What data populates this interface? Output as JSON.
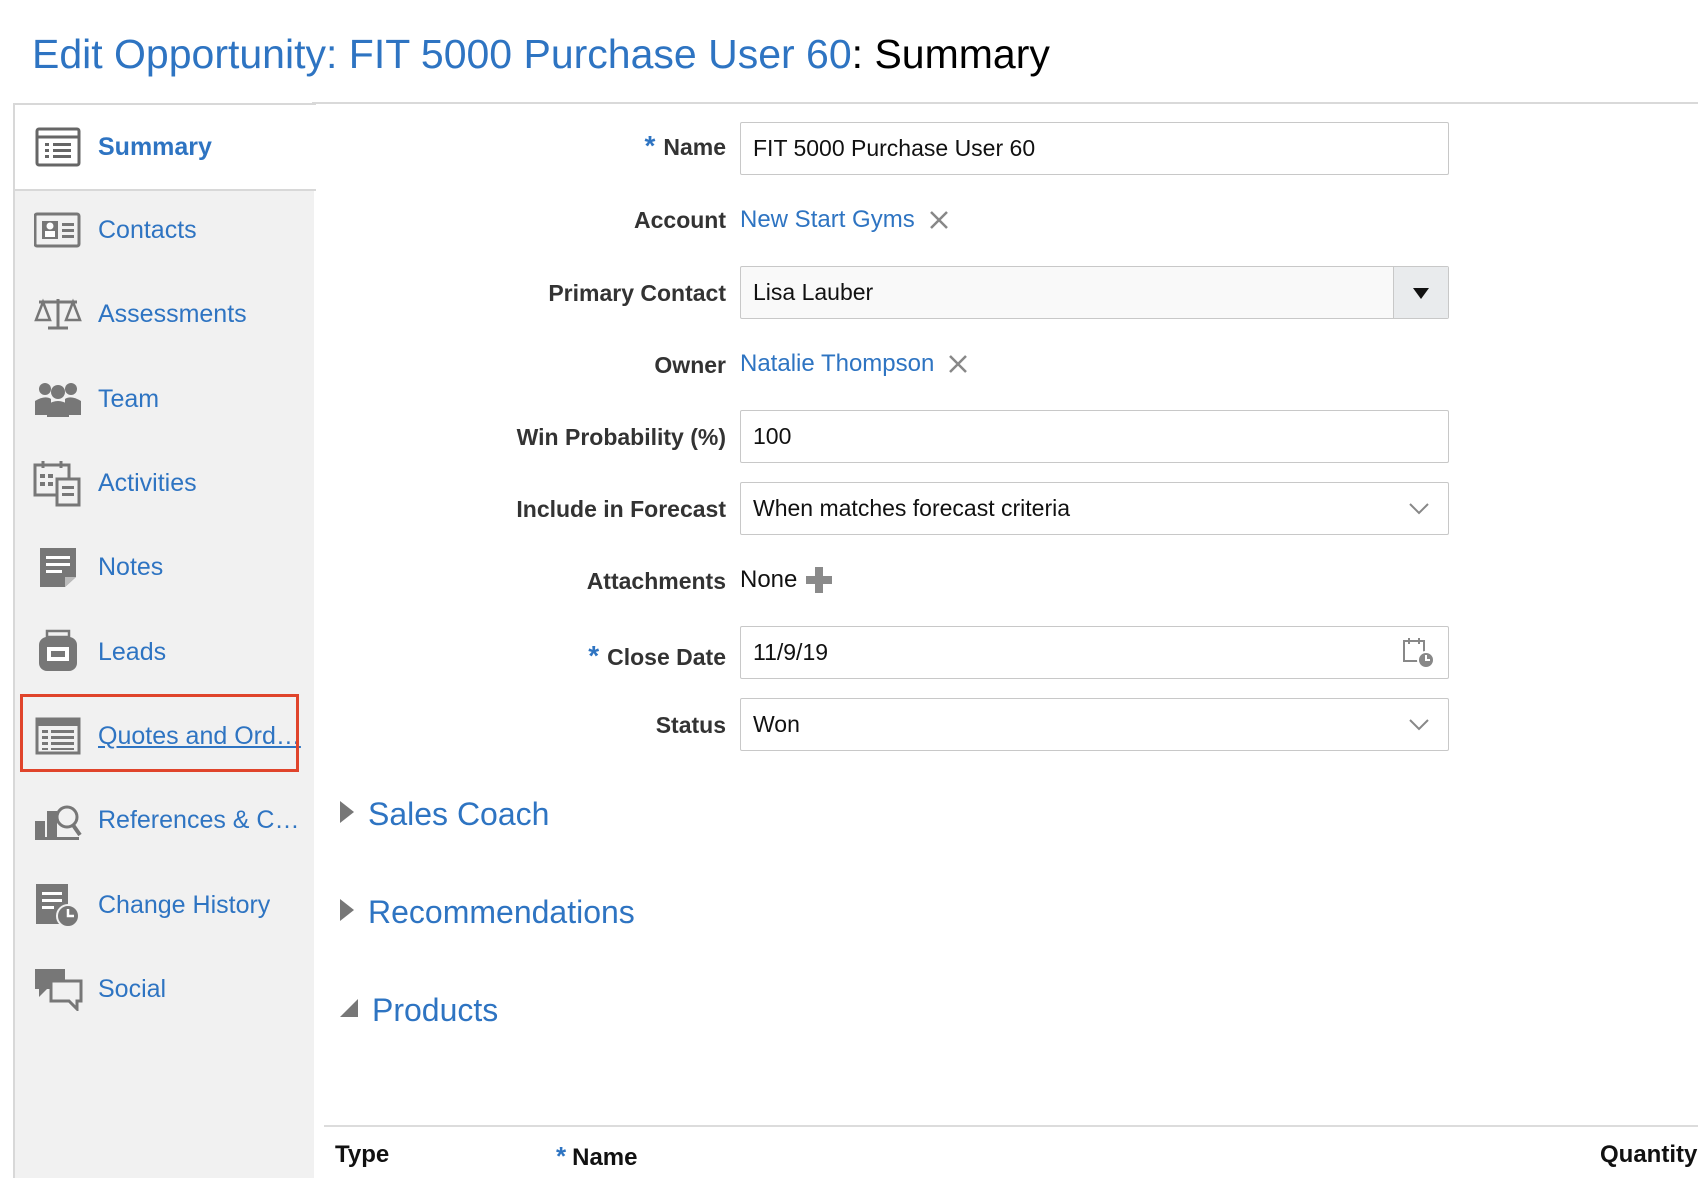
{
  "header": {
    "title_link": "Edit Opportunity: FIT 5000 Purchase User 60",
    "title_rest": ": Summary"
  },
  "sidebar": {
    "items": [
      {
        "label": "Summary",
        "icon": "summary-list-icon"
      },
      {
        "label": "Contacts",
        "icon": "contacts-card-icon"
      },
      {
        "label": "Assessments",
        "icon": "scales-icon"
      },
      {
        "label": "Team",
        "icon": "team-people-icon"
      },
      {
        "label": "Activities",
        "icon": "calendar-activities-icon"
      },
      {
        "label": "Notes",
        "icon": "notes-icon"
      },
      {
        "label": "Leads",
        "icon": "leads-icon"
      },
      {
        "label": "Quotes and Ord…",
        "icon": "quotes-table-icon"
      },
      {
        "label": "References & C…",
        "icon": "references-search-icon"
      },
      {
        "label": "Change History",
        "icon": "change-history-icon"
      },
      {
        "label": "Social",
        "icon": "social-chat-icon"
      }
    ]
  },
  "form": {
    "name_label": "Name",
    "name_value": "FIT 5000 Purchase User 60",
    "account_label": "Account",
    "account_value": "New Start Gyms",
    "primary_contact_label": "Primary Contact",
    "primary_contact_value": "Lisa Lauber",
    "owner_label": "Owner",
    "owner_value": "Natalie Thompson",
    "win_prob_label": "Win Probability (%)",
    "win_prob_value": "100",
    "forecast_label": "Include in Forecast",
    "forecast_value": "When matches forecast criteria",
    "attachments_label": "Attachments",
    "attachments_value": "None",
    "close_date_label": "Close Date",
    "close_date_value": "11/9/19",
    "status_label": "Status",
    "status_value": "Won",
    "required_mark": "*"
  },
  "sections": {
    "sales_coach": "Sales Coach",
    "recommendations": "Recommendations",
    "products": "Products"
  },
  "products_table": {
    "columns": [
      "Type",
      "Name",
      "Quantity"
    ]
  },
  "colors": {
    "link": "#2e74c2",
    "highlight_border": "#e0442b",
    "sidebar_bg": "#f1f1f1"
  }
}
